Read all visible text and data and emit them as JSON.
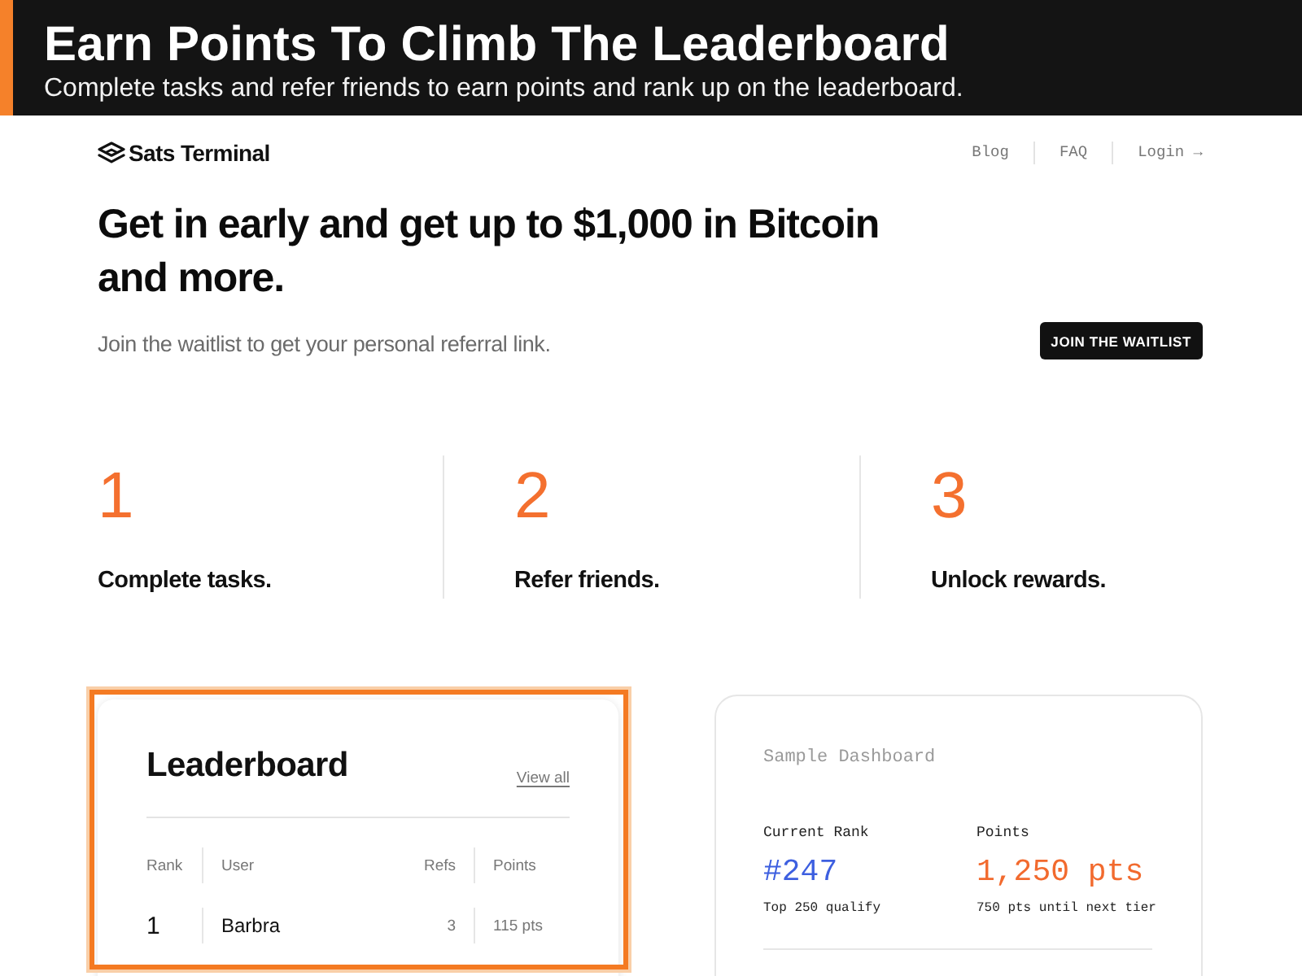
{
  "banner": {
    "title": "Earn Points To Climb The Leaderboard",
    "subtitle": "Complete tasks and refer friends to earn points and rank up on the leaderboard."
  },
  "nav": {
    "brand": "Sats Terminal",
    "links": [
      "Blog",
      "FAQ",
      "Login →"
    ]
  },
  "hero": {
    "headline": "Get in early and get up to $1,000 in Bitcoin and more.",
    "subtitle": "Join the waitlist to get your personal referral link.",
    "button": "JOIN THE WAITLIST"
  },
  "steps": [
    {
      "number": "1",
      "label": "Complete tasks."
    },
    {
      "number": "2",
      "label": "Refer friends."
    },
    {
      "number": "3",
      "label": "Unlock rewards."
    }
  ],
  "leaderboard": {
    "title": "Leaderboard",
    "link": "View all",
    "highlighted": true,
    "columns": [
      "Rank",
      "User",
      "Refs",
      "Points"
    ],
    "rows": [
      {
        "rank": "1",
        "user": "Barbra",
        "refs": "3",
        "points": "115 pts"
      }
    ]
  },
  "dashboard": {
    "title": "Sample Dashboard",
    "stats": [
      {
        "label": "Current Rank",
        "value": "#247",
        "note": "Top 250 qualify",
        "color": "#3d5fe0"
      },
      {
        "label": "Points",
        "value": "1,250 pts",
        "note": "750 pts until next tier",
        "color": "#f26a2e"
      }
    ]
  }
}
